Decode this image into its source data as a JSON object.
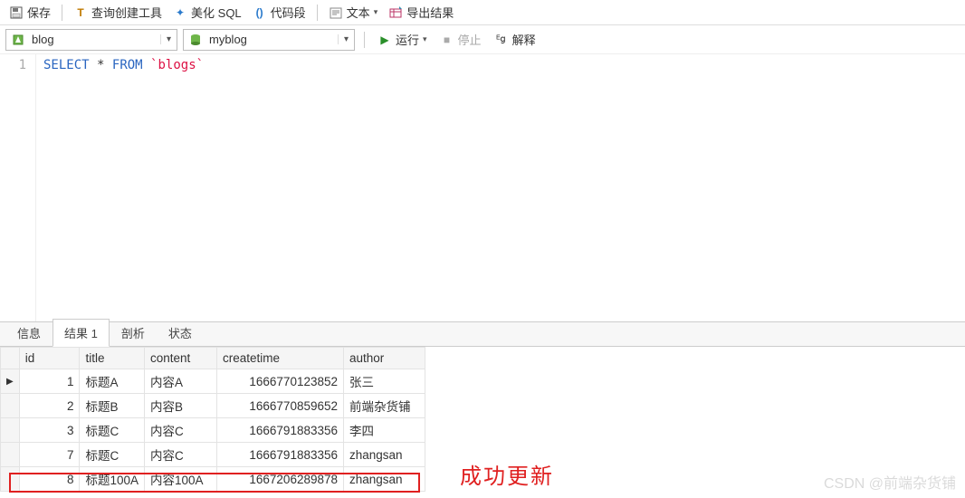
{
  "toolbar": {
    "save": "保存",
    "query_builder": "查询创建工具",
    "beautify_sql": "美化 SQL",
    "code_snippet": "代码段",
    "text": "文本",
    "export_result": "导出结果"
  },
  "selectors": {
    "database": "blog",
    "table": "myblog"
  },
  "actions": {
    "run": "运行",
    "stop": "停止",
    "explain": "解释"
  },
  "editor": {
    "line_number": "1",
    "kw_select": "SELECT",
    "star": "*",
    "kw_from": "FROM",
    "table_ref": "`blogs`"
  },
  "result_tabs": {
    "info": "信息",
    "result1": "结果 1",
    "profile": "剖析",
    "status": "状态"
  },
  "grid": {
    "columns": [
      "id",
      "title",
      "content",
      "createtime",
      "author"
    ],
    "rows": [
      {
        "id": "1",
        "title": "标题A",
        "content": "内容A",
        "createtime": "1666770123852",
        "author": "张三"
      },
      {
        "id": "2",
        "title": "标题B",
        "content": "内容B",
        "createtime": "1666770859652",
        "author": "前端杂货铺"
      },
      {
        "id": "3",
        "title": "标题C",
        "content": "内容C",
        "createtime": "1666791883356",
        "author": "李四"
      },
      {
        "id": "7",
        "title": "标题C",
        "content": "内容C",
        "createtime": "1666791883356",
        "author": "zhangsan"
      },
      {
        "id": "8",
        "title": "标题100A",
        "content": "内容100A",
        "createtime": "1667206289878",
        "author": "zhangsan"
      }
    ]
  },
  "annotation": "成功更新",
  "watermark": "CSDN @前端杂货铺"
}
